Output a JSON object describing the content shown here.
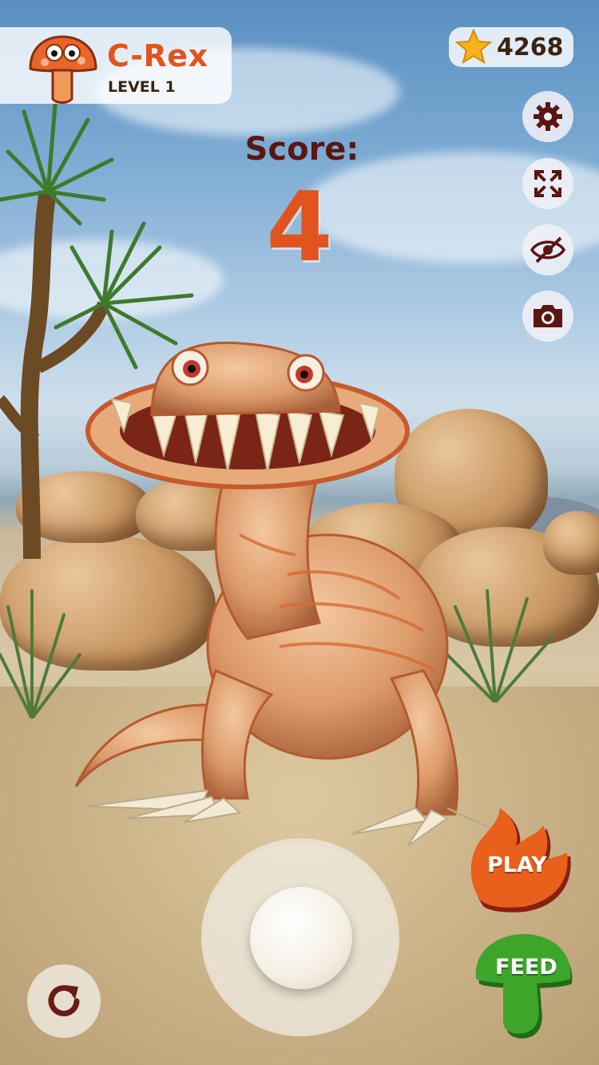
{
  "pet": {
    "name": "C-Rex",
    "level": "LEVEL 1",
    "mascot_icon": "mushroom-creature-icon"
  },
  "currency": {
    "icon": "star-icon",
    "value": "4268"
  },
  "score": {
    "label": "Score:",
    "value": "4"
  },
  "side_buttons": [
    {
      "name": "settings",
      "icon": "gear-icon"
    },
    {
      "name": "fullscreen",
      "icon": "expand-icon"
    },
    {
      "name": "visibility",
      "icon": "eye-off-icon"
    },
    {
      "name": "camera",
      "icon": "camera-icon"
    }
  ],
  "actions": {
    "play_label": "PLAY",
    "feed_label": "FEED",
    "reset_icon": "rotate-icon"
  },
  "colors": {
    "accent_orange": "#e2541f",
    "title_dark": "#5a1612",
    "play_fill": "#e8601c",
    "feed_fill": "#3ea52b"
  }
}
